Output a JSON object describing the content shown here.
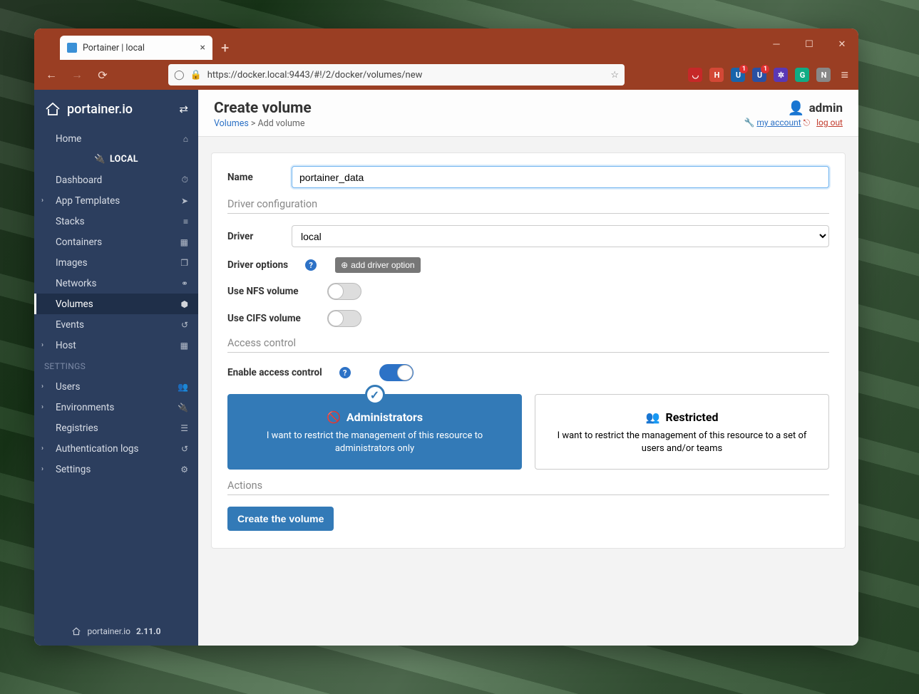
{
  "browser": {
    "tab_title": "Portainer | local",
    "url": "https://docker.local:9443/#!/2/docker/volumes/new"
  },
  "sidebar": {
    "brand": "portainer.io",
    "env_label": "LOCAL",
    "items": [
      {
        "label": "Home",
        "icon": "home",
        "chev": false
      },
      {
        "label": "Dashboard",
        "icon": "tach",
        "chev": false
      },
      {
        "label": "App Templates",
        "icon": "rocket",
        "chev": true
      },
      {
        "label": "Stacks",
        "icon": "list",
        "chev": false
      },
      {
        "label": "Containers",
        "icon": "cubes",
        "chev": false
      },
      {
        "label": "Images",
        "icon": "clone",
        "chev": false
      },
      {
        "label": "Networks",
        "icon": "sitemap",
        "chev": false
      },
      {
        "label": "Volumes",
        "icon": "hdd",
        "chev": false,
        "active": true
      },
      {
        "label": "Events",
        "icon": "history",
        "chev": false
      },
      {
        "label": "Host",
        "icon": "th",
        "chev": true
      }
    ],
    "settings_heading": "SETTINGS",
    "settings_items": [
      {
        "label": "Users",
        "icon": "users",
        "chev": true
      },
      {
        "label": "Environments",
        "icon": "plug",
        "chev": true
      },
      {
        "label": "Registries",
        "icon": "database",
        "chev": false
      },
      {
        "label": "Authentication logs",
        "icon": "history",
        "chev": true
      },
      {
        "label": "Settings",
        "icon": "cogs",
        "chev": true
      }
    ],
    "footer_brand": "portainer.io",
    "footer_version": "2.11.0"
  },
  "header": {
    "title": "Create volume",
    "breadcrumb_link": "Volumes",
    "breadcrumb_sep": " > ",
    "breadcrumb_current": "Add volume",
    "username": "admin",
    "my_account": "my account",
    "log_out": "log out"
  },
  "form": {
    "name_label": "Name",
    "name_value": "portainer_data",
    "driver_section": "Driver configuration",
    "driver_label": "Driver",
    "driver_value": "local",
    "driver_options_label": "Driver options",
    "add_driver_option": "add driver option",
    "use_nfs_label": "Use NFS volume",
    "use_cifs_label": "Use CIFS volume",
    "access_section": "Access control",
    "enable_access_label": "Enable access control",
    "admins_title": "Administrators",
    "admins_desc": "I want to restrict the management of this resource to administrators only",
    "restricted_title": "Restricted",
    "restricted_desc": "I want to restrict the management of this resource to a set of users and/or teams",
    "actions_section": "Actions",
    "create_button": "Create the volume"
  }
}
